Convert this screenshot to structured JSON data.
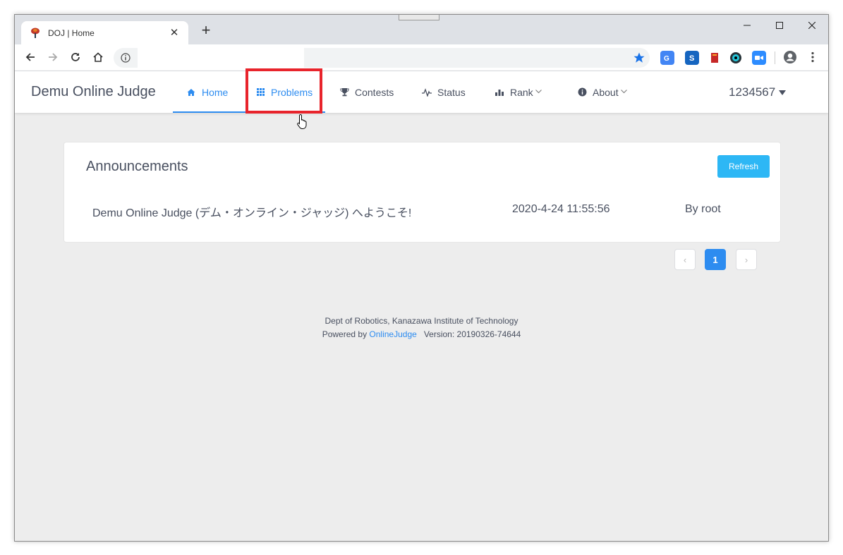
{
  "browser": {
    "tab_title": "DOJ | Home",
    "new_tab": "+",
    "tab_close": "✕"
  },
  "nav": {
    "brand": "Demu Online Judge",
    "items": [
      {
        "label": "Home",
        "icon": "home-icon"
      },
      {
        "label": "Problems",
        "icon": "grid-icon"
      },
      {
        "label": "Contests",
        "icon": "trophy-icon"
      },
      {
        "label": "Status",
        "icon": "pulse-icon"
      },
      {
        "label": "Rank",
        "icon": "bar-chart-icon"
      },
      {
        "label": "About",
        "icon": "info-icon"
      }
    ],
    "active": "Home",
    "user": "1234567"
  },
  "announcements": {
    "title": "Announcements",
    "refresh_label": "Refresh",
    "items": [
      {
        "title": "Demu Online Judge (デム・オンライン・ジャッジ) へようこそ!",
        "date": "2020-4-24 11:55:56",
        "by": "By root"
      }
    ]
  },
  "pagination": {
    "prev": "‹",
    "current": "1",
    "next": "›"
  },
  "footer": {
    "org": "Dept of Robotics, Kanazawa Institute of Technology",
    "powered_prefix": "Powered by",
    "powered_link": "OnlineJudge",
    "version": "Version: 20190326-74644"
  },
  "colors": {
    "accent": "#2d8cf0",
    "refresh": "#2db7f5",
    "highlight": "#e8242c"
  }
}
